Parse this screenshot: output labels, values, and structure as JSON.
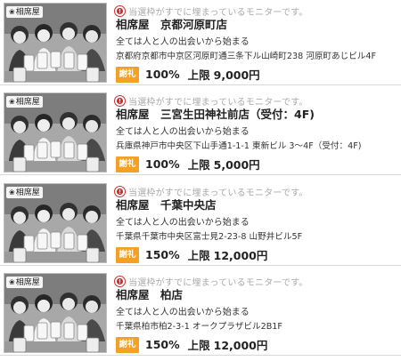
{
  "notice_text": "当選枠がすでに埋まっているモニターです。",
  "logo_text": "相席屋",
  "badge_label": "謝礼",
  "limit_label": "上限",
  "colors": {
    "badge": "#f3a024",
    "notice_text": "#aaaaaa"
  },
  "listings": [
    {
      "name": "相席屋　京都河原町店",
      "tagline": "全ては人と人の出会いから始まる",
      "address": "京都府京都市中京区河原町通三条下ル山崎町238 河原町あじビル4F",
      "rate": "100%",
      "limit": "9,000円"
    },
    {
      "name": "相席屋　三宮生田神社前店（受付：4F)",
      "tagline": "全ては人と人の出会いから始まる",
      "address": "兵庫県神戸市中央区下山手通1-1-1 東新ビル 3〜4F（受付：4F)",
      "rate": "100%",
      "limit": "5,000円"
    },
    {
      "name": "相席屋　千葉中央店",
      "tagline": "全ては人と人の出会いから始まる",
      "address": "千葉県千葉市中央区富士見2-23-8 山野井ビル5F",
      "rate": "150%",
      "limit": "12,000円"
    },
    {
      "name": "相席屋　柏店",
      "tagline": "全ては人と人の出会いから始まる",
      "address": "千葉県柏市柏2-3-1 オークプラザビル2B1F",
      "rate": "150%",
      "limit": "12,000円"
    }
  ]
}
